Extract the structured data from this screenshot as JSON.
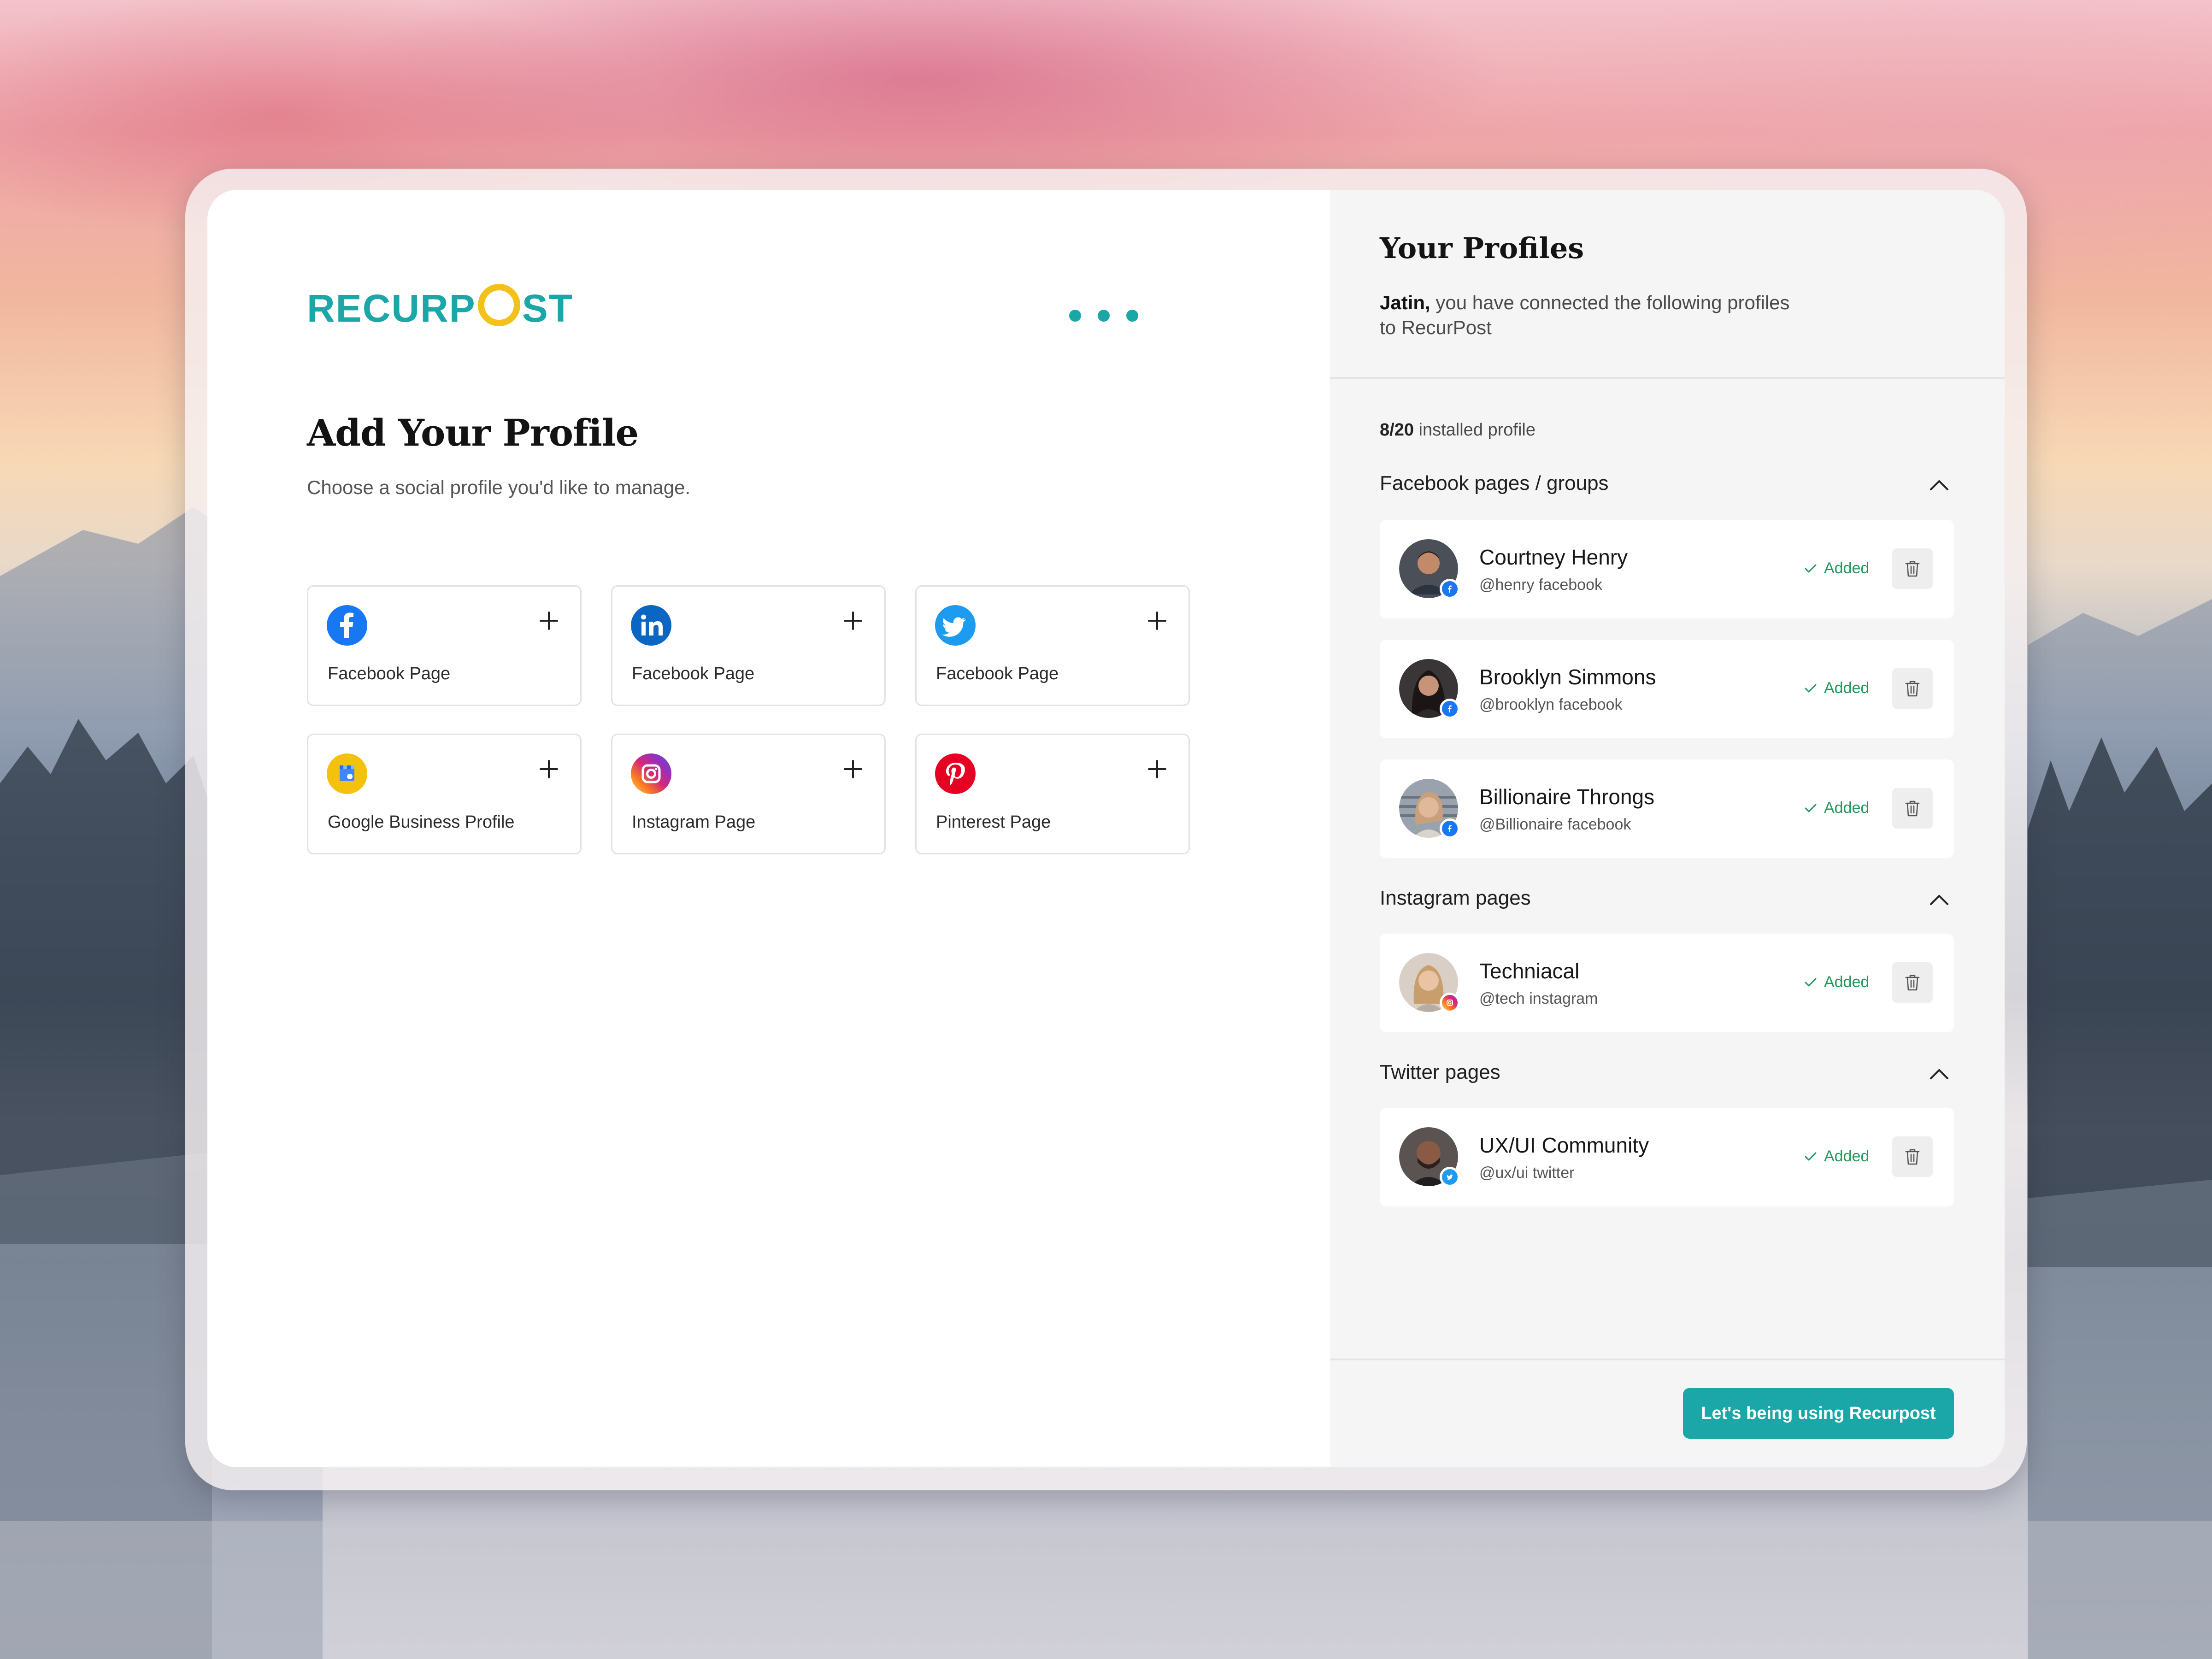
{
  "brand": {
    "logo_text_a": "RECURP",
    "logo_text_b": "ST",
    "accent": "#1ba6a8",
    "logo_clock_color": "#f3c21a"
  },
  "left": {
    "title": "Add Your Profile",
    "subtitle": "Choose a social profile you'd like to manage.",
    "tiles": [
      {
        "label": "Facebook Page",
        "icon": "facebook-icon",
        "color": "#1877f2"
      },
      {
        "label": "Facebook Page",
        "icon": "linkedin-icon",
        "color": "#0a66c2"
      },
      {
        "label": "Facebook Page",
        "icon": "twitter-icon",
        "color": "#1d9bf0"
      },
      {
        "label": "Google Business Profile",
        "icon": "google-business-icon",
        "color": "#f4c20d"
      },
      {
        "label": "Instagram Page",
        "icon": "instagram-icon",
        "color": "#d62976"
      },
      {
        "label": "Pinterest Page",
        "icon": "pinterest-icon",
        "color": "#e60023"
      }
    ]
  },
  "right": {
    "title": "Your Profiles",
    "desc_name": "Jatin,",
    "desc_rest": " you have connected the following profiles to RecurPost",
    "count_num": "8/20",
    "count_text": " installed profile",
    "sections": [
      {
        "title": "Facebook pages / groups",
        "profiles": [
          {
            "name": "Courtney Henry",
            "handle": "@henry facebook",
            "status": "Added",
            "network": "facebook"
          },
          {
            "name": "Brooklyn Simmons",
            "handle": "@brooklyn facebook",
            "status": "Added",
            "network": "facebook"
          },
          {
            "name": "Billionaire Throngs",
            "handle": "@Billionaire facebook",
            "status": "Added",
            "network": "facebook"
          }
        ]
      },
      {
        "title": "Instagram pages",
        "profiles": [
          {
            "name": "Techniacal",
            "handle": "@tech instagram",
            "status": "Added",
            "network": "instagram"
          }
        ]
      },
      {
        "title": "Twitter pages",
        "profiles": [
          {
            "name": "UX/UI Community",
            "handle": "@ux/ui twitter",
            "status": "Added",
            "network": "twitter"
          }
        ]
      }
    ],
    "cta_label": "Let's being using Recurpost"
  }
}
